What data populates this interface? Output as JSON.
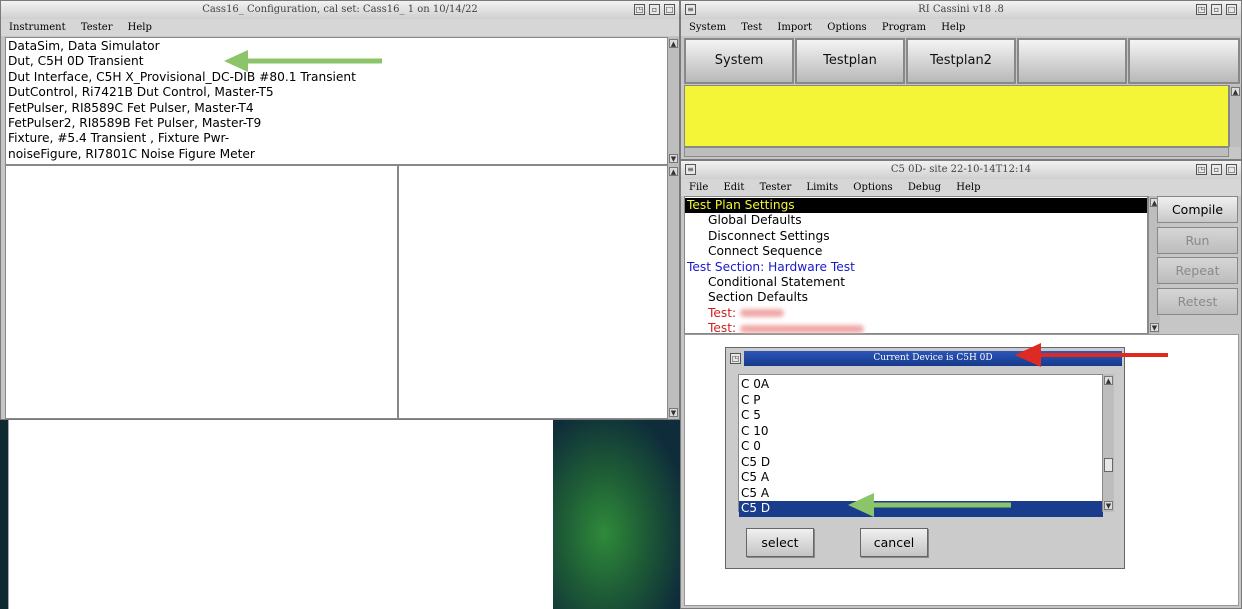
{
  "config_window": {
    "title": "Cass16_ Configuration, cal set: Cass16_ 1 on 10/14/22",
    "menu": [
      "Instrument",
      "Tester",
      "Help"
    ],
    "lines": [
      "DataSim,  Data Simulator",
      "Dut,  C5H 0D Transient",
      "Dut Interface,  C5H X_Provisional_DC-DIB #80.1 Transient",
      "DutControl,  Ri7421B Dut Control, Master-T5",
      "FetPulser,  RI8589C Fet Pulser, Master-T4",
      "FetPulser2,  RI8589B Fet Pulser, Master-T9",
      "Fixture,  #5.4 Transient , Fixture Pwr-",
      "noiseFigure,  RI7801C Noise Figure Meter"
    ]
  },
  "main_window": {
    "title": "RI Cassini v18 .8",
    "menu": [
      "System",
      "Test",
      "Import",
      "Options",
      "Program",
      "Help"
    ],
    "tabs": [
      "System",
      "Testplan",
      "Testplan2",
      "",
      ""
    ]
  },
  "testplan_window": {
    "title": "C5 0D- site 22-10-14T12:14",
    "menu": [
      "File",
      "Edit",
      "Tester",
      "Limits",
      "Options",
      "Debug",
      "Help"
    ],
    "tree": [
      {
        "text": "Test Plan Settings",
        "indent": 0,
        "style": "selected"
      },
      {
        "text": "Global Defaults",
        "indent": 1,
        "style": "normal"
      },
      {
        "text": "Disconnect Settings",
        "indent": 1,
        "style": "normal"
      },
      {
        "text": "Connect Sequence",
        "indent": 1,
        "style": "normal"
      },
      {
        "text": "Test Section: Hardware Test",
        "indent": 0,
        "style": "section"
      },
      {
        "text": "Conditional Statement",
        "indent": 1,
        "style": "normal"
      },
      {
        "text": "Section Defaults",
        "indent": 1,
        "style": "normal"
      },
      {
        "text": "Test:",
        "indent": 1,
        "style": "test"
      },
      {
        "text": "Test:",
        "indent": 1,
        "style": "test"
      }
    ],
    "buttons": [
      {
        "label": "Compile",
        "enabled": true
      },
      {
        "label": "Run",
        "enabled": false
      },
      {
        "label": "Repeat",
        "enabled": false
      },
      {
        "label": "Retest",
        "enabled": false
      }
    ]
  },
  "device_dialog": {
    "title": "Current Device is C5H 0D",
    "items": [
      "C 0A",
      "C P",
      "C 5",
      "C 10",
      "C 0",
      "C5 D",
      "C5 A",
      "C5 A",
      "C5 D"
    ],
    "selected_index": 8,
    "select_label": "select",
    "cancel_label": "cancel"
  },
  "colors": {
    "yellow_panel": "#f5f537",
    "title_blue": "#1a3c8c",
    "section_blue": "#1a1acc",
    "test_red": "#cc2222",
    "arrow_green": "#8cc46a",
    "arrow_red": "#dd2a22"
  }
}
